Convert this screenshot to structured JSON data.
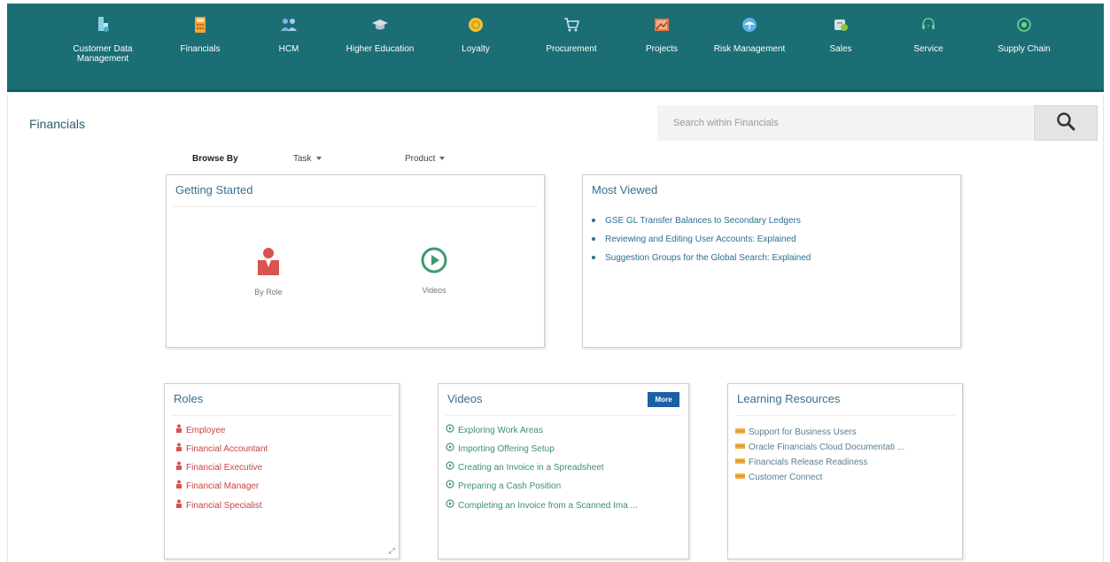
{
  "nav": {
    "items": [
      {
        "label": "Customer Data Management",
        "icon": "customer-data-icon",
        "color": "#8ad1e0"
      },
      {
        "label": "Financials",
        "icon": "calculator-icon",
        "color": "#f3a33b"
      },
      {
        "label": "HCM",
        "icon": "people-icon",
        "color": "#7fb2e8"
      },
      {
        "label": "Higher Education",
        "icon": "graduation-cap-icon",
        "color": "#d8dde6"
      },
      {
        "label": "Loyalty",
        "icon": "coin-icon",
        "color": "#f2c232"
      },
      {
        "label": "Procurement",
        "icon": "cart-icon",
        "color": "#cfe6ee"
      },
      {
        "label": "Projects",
        "icon": "projects-icon",
        "color": "#e27a45"
      },
      {
        "label": "Risk Management",
        "icon": "umbrella-icon",
        "color": "#5bb0e5"
      },
      {
        "label": "Sales",
        "icon": "sales-icon",
        "color": "#d9dee3"
      },
      {
        "label": "Service",
        "icon": "headset-icon",
        "color": "#5fcf9a"
      },
      {
        "label": "Supply Chain",
        "icon": "supply-chain-icon",
        "color": "#6fd58a"
      }
    ]
  },
  "page": {
    "title": "Financials",
    "search_placeholder": "Search within Financials"
  },
  "browse": {
    "label": "Browse By",
    "task": "Task",
    "product": "Product"
  },
  "getting_started": {
    "title": "Getting Started",
    "items": [
      {
        "label": "By Role",
        "icon": "person-icon"
      },
      {
        "label": "Videos",
        "icon": "play-icon"
      }
    ]
  },
  "most_viewed": {
    "title": "Most Viewed",
    "items": [
      "GSE GL Transfer Balances to Secondary Ledgers",
      "Reviewing and Editing User Accounts: Explained",
      "Suggestion Groups for the Global Search: Explained"
    ]
  },
  "roles": {
    "title": "Roles",
    "items": [
      "Employee",
      "Financial Accountant",
      "Financial Executive",
      "Financial Manager",
      "Financial Specialist"
    ]
  },
  "videos": {
    "title": "Videos",
    "more": "More",
    "items": [
      "Exploring Work Areas",
      "Importing Offering Setup",
      "Creating an Invoice in a Spreadsheet",
      "Preparing a Cash Position",
      "Completing an Invoice from a Scanned Ima ..."
    ]
  },
  "learning": {
    "title": "Learning Resources",
    "items": [
      "Support for Business Users",
      "Oracle Financials Cloud Documentati ...",
      "Financials Release Readiness",
      "Customer Connect"
    ]
  },
  "colors": {
    "navbar": "#1a6e74",
    "role_red": "#d9534f",
    "video_green": "#3f9a6f",
    "more_blue": "#1d5ea8"
  }
}
